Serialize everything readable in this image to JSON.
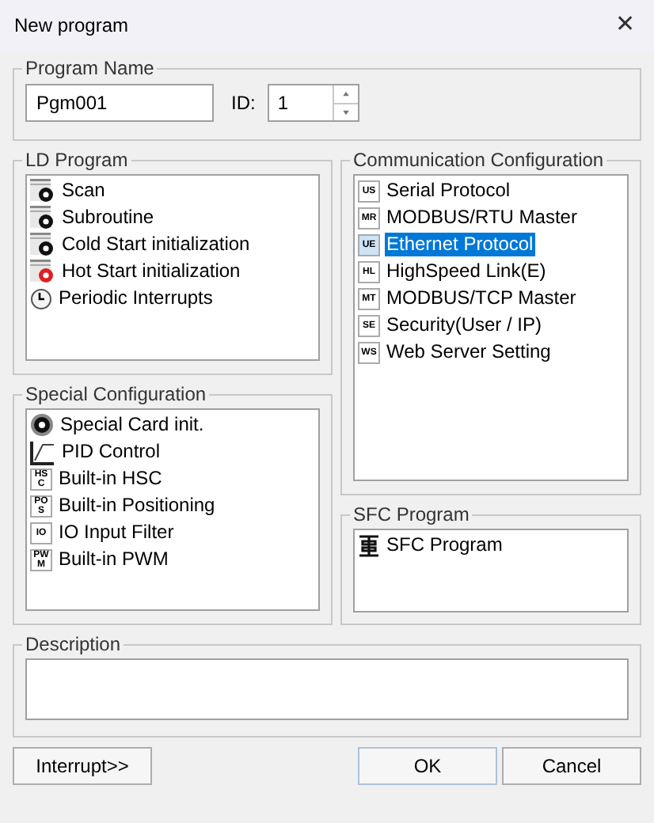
{
  "window": {
    "title": "New program",
    "close": "✕"
  },
  "program_name": {
    "title": "Program Name",
    "name_value": "Pgm001",
    "id_label": "ID:",
    "id_value": "1"
  },
  "ld_program": {
    "title": "LD Program",
    "items": [
      {
        "label": "Scan",
        "selected": false
      },
      {
        "label": "Subroutine",
        "selected": false
      },
      {
        "label": "Cold Start initialization",
        "selected": false
      },
      {
        "label": "Hot Start initialization",
        "selected": false
      },
      {
        "label": "Periodic Interrupts",
        "selected": false
      }
    ]
  },
  "communication": {
    "title": "Communication Configuration",
    "items": [
      {
        "badge": "US",
        "label": "Serial Protocol",
        "selected": false
      },
      {
        "badge": "MR",
        "label": "MODBUS/RTU Master",
        "selected": false
      },
      {
        "badge": "UE",
        "label": "Ethernet Protocol",
        "selected": true
      },
      {
        "badge": "HL",
        "label": "HighSpeed Link(E)",
        "selected": false
      },
      {
        "badge": "MT",
        "label": "MODBUS/TCP Master",
        "selected": false
      },
      {
        "badge": "SE",
        "label": "Security(User / IP)",
        "selected": false
      },
      {
        "badge": "WS",
        "label": "Web Server Setting",
        "selected": false
      }
    ]
  },
  "special": {
    "title": "Special Configuration",
    "items": [
      {
        "kind": "icon",
        "label": "Special Card init.",
        "selected": false
      },
      {
        "kind": "icon",
        "label": "PID Control",
        "selected": false
      },
      {
        "kind": "badge",
        "badge": "HSC",
        "label": "Built-in HSC",
        "selected": false
      },
      {
        "kind": "badge",
        "badge": "POS",
        "label": "Built-in Positioning",
        "selected": false
      },
      {
        "kind": "badge",
        "badge": "IO",
        "label": "IO Input Filter",
        "selected": false
      },
      {
        "kind": "badge",
        "badge": "PWM",
        "label": "Built-in PWM",
        "selected": false
      }
    ]
  },
  "sfc": {
    "title": "SFC Program",
    "items": [
      {
        "label": "SFC Program",
        "selected": false
      }
    ]
  },
  "description": {
    "title": "Description"
  },
  "buttons": {
    "interrupt": "Interrupt>>",
    "ok": "OK",
    "cancel": "Cancel"
  }
}
